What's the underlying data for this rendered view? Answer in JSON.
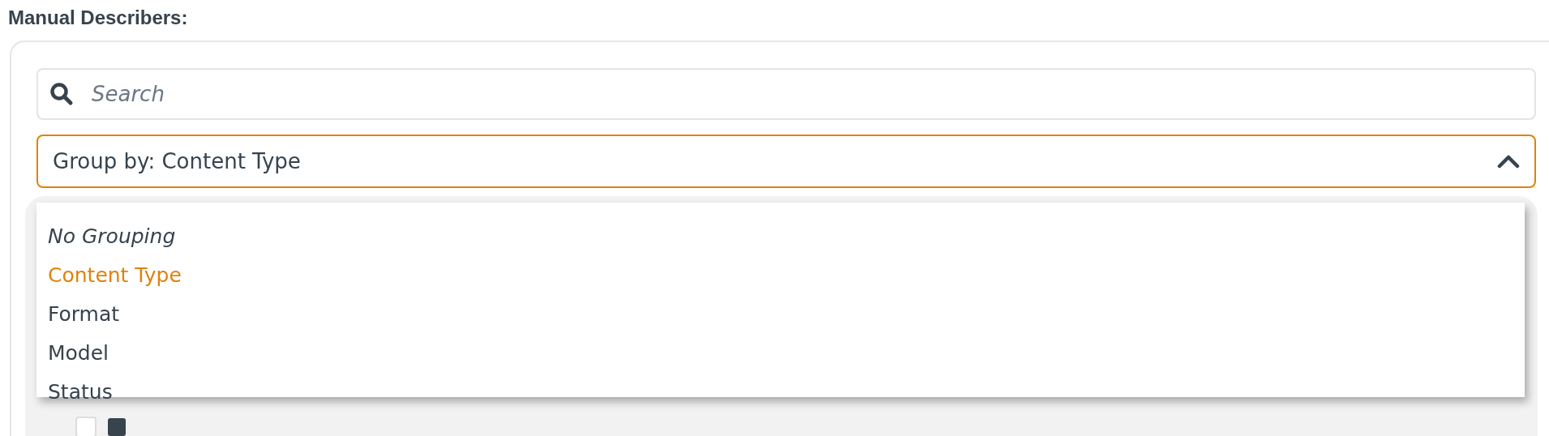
{
  "heading": "Manual Describers:",
  "search": {
    "placeholder": "Search"
  },
  "group_by": {
    "value": "Group by: Content Type",
    "expanded": true
  },
  "options": [
    {
      "label": "No Grouping",
      "kind": "none",
      "selected": false
    },
    {
      "label": "Content Type",
      "kind": "option",
      "selected": true
    },
    {
      "label": "Format",
      "kind": "option",
      "selected": false
    },
    {
      "label": "Model",
      "kind": "option",
      "selected": false
    },
    {
      "label": "Status",
      "kind": "option",
      "selected": false
    }
  ],
  "hidden_row": {
    "checked": false
  }
}
